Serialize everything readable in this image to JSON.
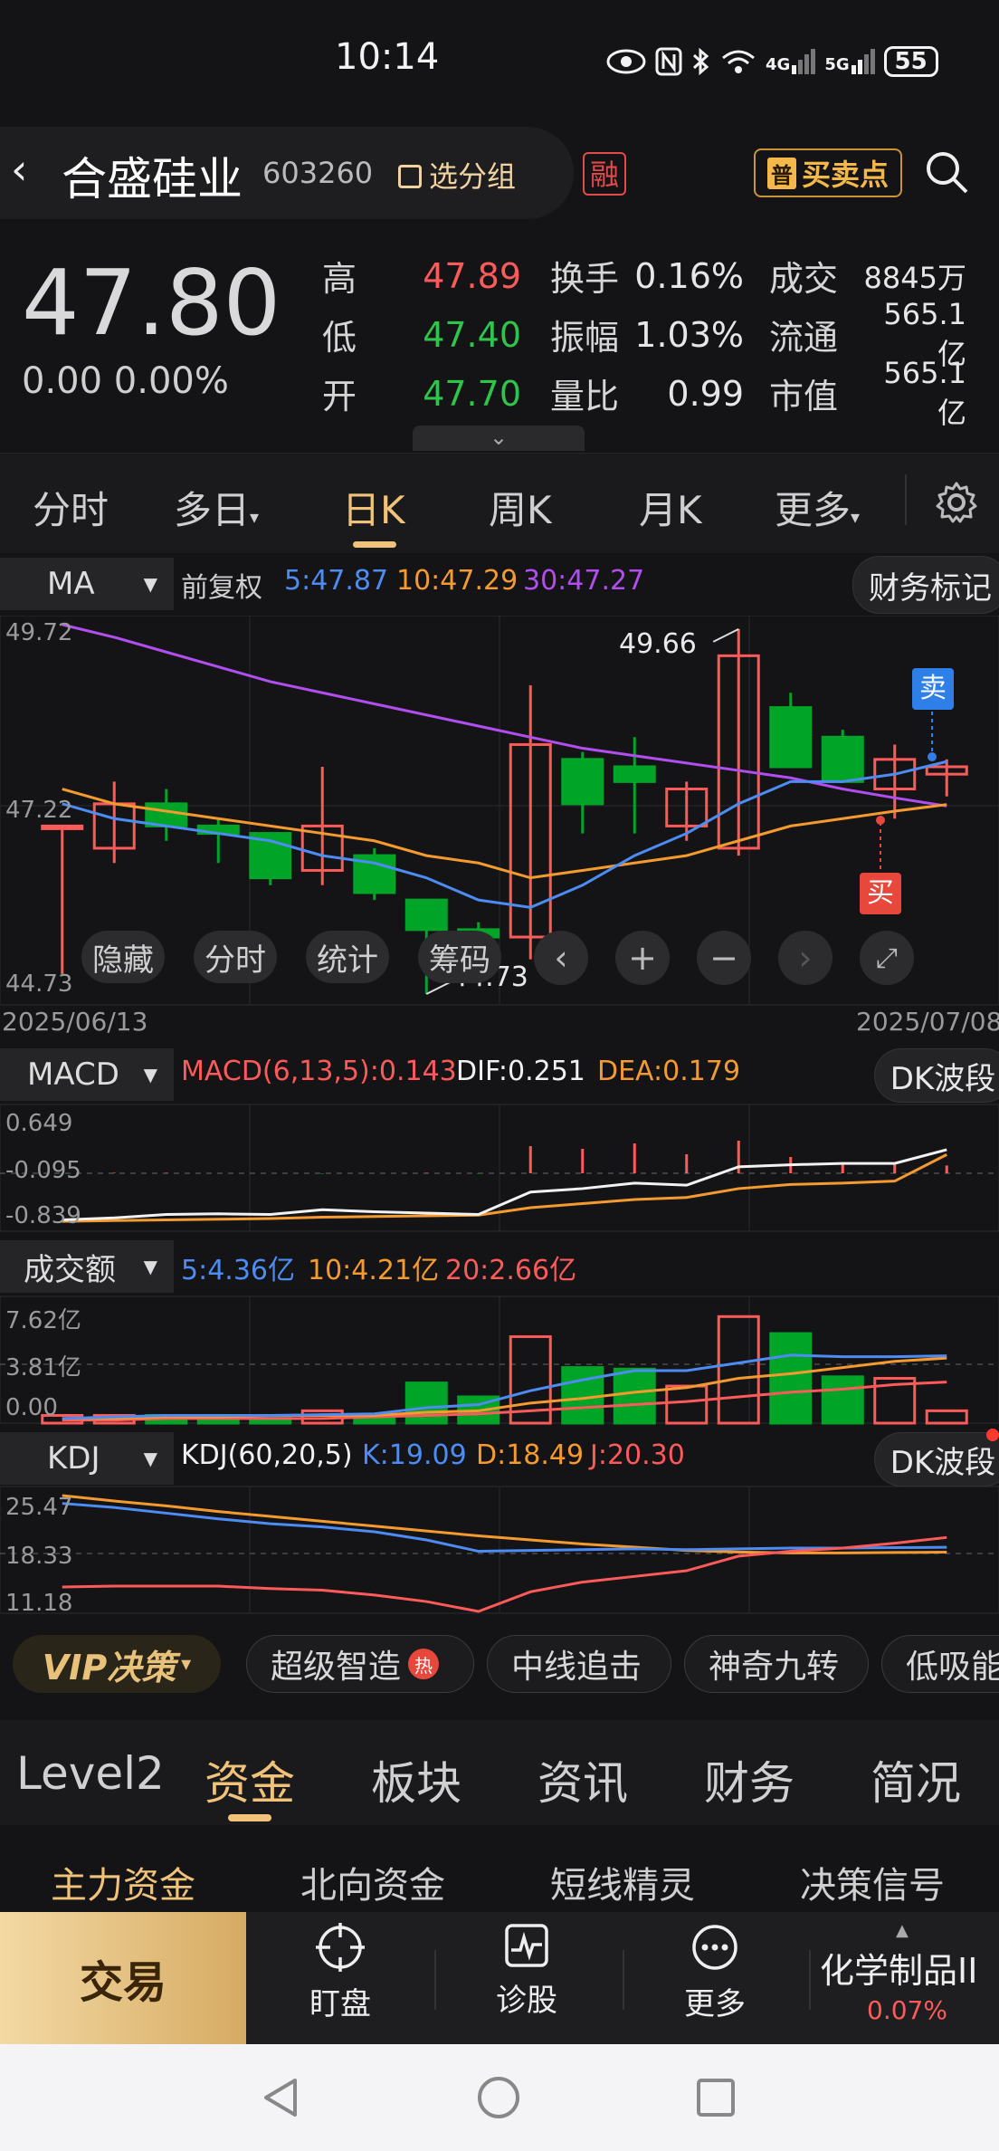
{
  "status": {
    "time": "10:14",
    "icons": [
      "eye-icon",
      "nfc-icon",
      "bluetooth-icon",
      "wifi-icon",
      "4g-signal-icon",
      "5g-signal-icon"
    ],
    "net1": "4G",
    "net2": "5G",
    "battery": "55"
  },
  "header": {
    "name": "合盛硅业",
    "code": "603260",
    "watch_label": "选分组",
    "rong": "融",
    "bs_badge": "普",
    "bs_label": "买卖点"
  },
  "quote": {
    "price": "47.80",
    "change": "0.00 0.00%",
    "rows": [
      {
        "k1": "高",
        "v1": "47.89",
        "c1": "#ff5a5a",
        "k2": "换手",
        "v2": "0.16%",
        "k3": "成交",
        "v3": "8845万"
      },
      {
        "k1": "低",
        "v1": "47.40",
        "c1": "#2fc44a",
        "k2": "振幅",
        "v2": "1.03%",
        "k3": "流通",
        "v3": "565.1亿"
      },
      {
        "k1": "开",
        "v1": "47.70",
        "c1": "#2fc44a",
        "k2": "量比",
        "v2": "0.99",
        "k3": "市值",
        "v3": "565.1亿"
      }
    ]
  },
  "tabs": [
    "分时",
    "多日",
    "日K",
    "周K",
    "月K",
    "更多"
  ],
  "active_tab": "日K",
  "kline_bar": {
    "indicator": "MA",
    "fq": "前复权",
    "ma5": "5:47.87",
    "ma10": "10:47.29",
    "ma30": "30:47.27",
    "finance_label": "财务标记"
  },
  "kline_axis": {
    "top": "49.72",
    "mid": "47.22",
    "bottom": "44.73",
    "high_label": "49.66",
    "low_label": "44.73",
    "date_start": "2025/06/13",
    "date_end": "2025/07/08"
  },
  "chart_buttons": [
    "隐藏",
    "分时",
    "统计",
    "筹码"
  ],
  "signals": {
    "sell": "卖",
    "buy": "买"
  },
  "macd": {
    "label": "MACD",
    "value": "MACD(6,13,5):0.143",
    "dif": "DIF:0.251",
    "dea": "DEA:0.179",
    "tag": "DK波段",
    "y1": "0.649",
    "y2": "-0.095",
    "y3": "-0.839"
  },
  "vol": {
    "label": "成交额",
    "ma5": "5:4.36亿",
    "ma10": "10:4.21亿",
    "ma20": "20:2.66亿",
    "y1": "7.62亿",
    "y2": "3.81亿",
    "y3": "0.00"
  },
  "kdj": {
    "label": "KDJ",
    "params": "KDJ(60,20,5)",
    "k": "K:19.09",
    "d": "D:18.49",
    "j": "J:20.30",
    "tag": "DK波段",
    "y1": "25.47",
    "y2": "18.33",
    "y3": "11.18"
  },
  "strategies": {
    "vip": "VIP决策",
    "items": [
      "超级智造",
      "中线追击",
      "神奇九转",
      "低吸能"
    ],
    "hot": "热"
  },
  "bottom_tabs": [
    "Level2",
    "资金",
    "板块",
    "资讯",
    "财务",
    "简况"
  ],
  "bottom_active": "资金",
  "sub_tabs": [
    "主力资金",
    "北向资金",
    "短线精灵",
    "决策信号"
  ],
  "bottombar": {
    "trade": "交易",
    "watch": "盯盘",
    "diag": "诊股",
    "more": "更多",
    "sector": "化学制品II",
    "sector_pct": "0.07%"
  },
  "colors": {
    "up": "#ff5a5a",
    "down": "#00a528",
    "gold": "#f0c27a",
    "ma5": "#4d8cf5",
    "ma10": "#f59a2e",
    "ma30": "#b24ef0"
  },
  "chart_data": [
    {
      "type": "candlestick",
      "title": "日K",
      "x": [
        "2025/06/13",
        "",
        "",
        "",
        "",
        "",
        "",
        "",
        "",
        "",
        "",
        "",
        "",
        "",
        "",
        "",
        "",
        "2025/07/08"
      ],
      "ohlc": [
        [
          47.0,
          47.0,
          45.0,
          47.0
        ],
        [
          46.7,
          47.6,
          46.5,
          47.3
        ],
        [
          47.3,
          47.5,
          46.8,
          47.0
        ],
        [
          47.0,
          47.1,
          46.5,
          46.9
        ],
        [
          46.9,
          46.9,
          46.2,
          46.3
        ],
        [
          46.4,
          47.8,
          46.2,
          47.0
        ],
        [
          46.6,
          46.7,
          46.0,
          46.1
        ],
        [
          46.0,
          46.0,
          44.73,
          45.6
        ],
        [
          45.6,
          45.7,
          45.4,
          45.5
        ],
        [
          45.5,
          48.9,
          45.2,
          48.1
        ],
        [
          47.9,
          48.0,
          46.9,
          47.3
        ],
        [
          47.8,
          48.2,
          46.9,
          47.6
        ],
        [
          47.0,
          47.6,
          46.8,
          47.5
        ],
        [
          46.7,
          49.66,
          46.6,
          49.3
        ],
        [
          48.6,
          48.8,
          47.8,
          47.8
        ],
        [
          48.2,
          48.3,
          47.7,
          47.6
        ],
        [
          47.5,
          48.1,
          47.1,
          47.9
        ],
        [
          47.7,
          47.9,
          47.4,
          47.8
        ]
      ],
      "ma5": [
        47.3,
        47.1,
        47.0,
        46.9,
        46.8,
        46.6,
        46.5,
        46.3,
        46.0,
        45.9,
        46.2,
        46.6,
        46.9,
        47.3,
        47.6,
        47.6,
        47.7,
        47.87
      ],
      "ma10": [
        47.5,
        47.3,
        47.2,
        47.1,
        47.0,
        46.9,
        46.8,
        46.6,
        46.5,
        46.3,
        46.4,
        46.5,
        46.6,
        46.8,
        47.0,
        47.1,
        47.2,
        47.29
      ],
      "ma30": [
        49.72,
        49.55,
        49.35,
        49.15,
        48.95,
        48.8,
        48.65,
        48.5,
        48.35,
        48.2,
        48.05,
        47.95,
        47.85,
        47.75,
        47.65,
        47.5,
        47.38,
        47.27
      ],
      "ylim": [
        44.73,
        49.72
      ]
    },
    {
      "type": "bar",
      "title": "MACD",
      "values": [
        -0.02,
        0.01,
        0.01,
        0.0,
        0.0,
        -0.01,
        0.0,
        0.01,
        -0.01,
        0.5,
        0.45,
        0.55,
        0.35,
        0.6,
        0.3,
        0.2,
        0.16,
        0.143
      ],
      "dif": [
        -0.78,
        -0.75,
        -0.7,
        -0.69,
        -0.7,
        -0.63,
        -0.66,
        -0.68,
        -0.7,
        -0.37,
        -0.32,
        -0.24,
        -0.27,
        -0.0,
        0.03,
        0.05,
        0.05,
        0.251
      ],
      "dea": [
        -0.8,
        -0.79,
        -0.78,
        -0.77,
        -0.76,
        -0.74,
        -0.73,
        -0.72,
        -0.71,
        -0.6,
        -0.54,
        -0.48,
        -0.45,
        -0.32,
        -0.26,
        -0.24,
        -0.21,
        0.179
      ],
      "ylim": [
        -0.839,
        0.649
      ]
    },
    {
      "type": "bar",
      "title": "成交额",
      "values": [
        0.5,
        0.5,
        0.5,
        0.5,
        0.5,
        0.8,
        0.5,
        2.6,
        1.7,
        5.6,
        3.6,
        3.5,
        2.4,
        6.9,
        5.8,
        3.0,
        2.9,
        0.8
      ],
      "ma5": [
        0.3,
        0.4,
        0.5,
        0.5,
        0.5,
        0.55,
        0.6,
        1.0,
        1.2,
        2.1,
        2.8,
        3.4,
        3.4,
        3.9,
        4.4,
        4.3,
        4.3,
        4.36
      ],
      "ma10": [
        0.3,
        0.3,
        0.4,
        0.4,
        0.5,
        0.5,
        0.5,
        0.7,
        0.8,
        1.3,
        1.6,
        2.0,
        2.3,
        2.9,
        3.2,
        3.6,
        4.0,
        4.21
      ],
      "ma20": [
        0.2,
        0.2,
        0.3,
        0.3,
        0.3,
        0.3,
        0.4,
        0.5,
        0.6,
        0.8,
        1.0,
        1.2,
        1.4,
        1.7,
        2.0,
        2.2,
        2.5,
        2.66
      ],
      "ylim": [
        0.0,
        7.62
      ]
    },
    {
      "type": "line",
      "title": "KDJ",
      "K": [
        24.5,
        24.0,
        23.3,
        22.6,
        22.0,
        21.6,
        21.0,
        20.0,
        18.6,
        18.7,
        18.8,
        18.9,
        18.8,
        18.9,
        19.0,
        19.0,
        19.05,
        19.09
      ],
      "D": [
        25.47,
        24.8,
        24.2,
        23.5,
        22.9,
        22.3,
        21.7,
        21.1,
        20.5,
        20.0,
        19.5,
        19.1,
        18.7,
        18.5,
        18.4,
        18.4,
        18.45,
        18.49
      ],
      "J": [
        14.2,
        14.3,
        14.3,
        14.3,
        14.0,
        13.8,
        13.2,
        12.4,
        11.18,
        13.6,
        14.8,
        15.5,
        16.2,
        18.0,
        18.6,
        19.0,
        19.6,
        20.3
      ],
      "ylim": [
        11.18,
        25.47
      ]
    }
  ]
}
